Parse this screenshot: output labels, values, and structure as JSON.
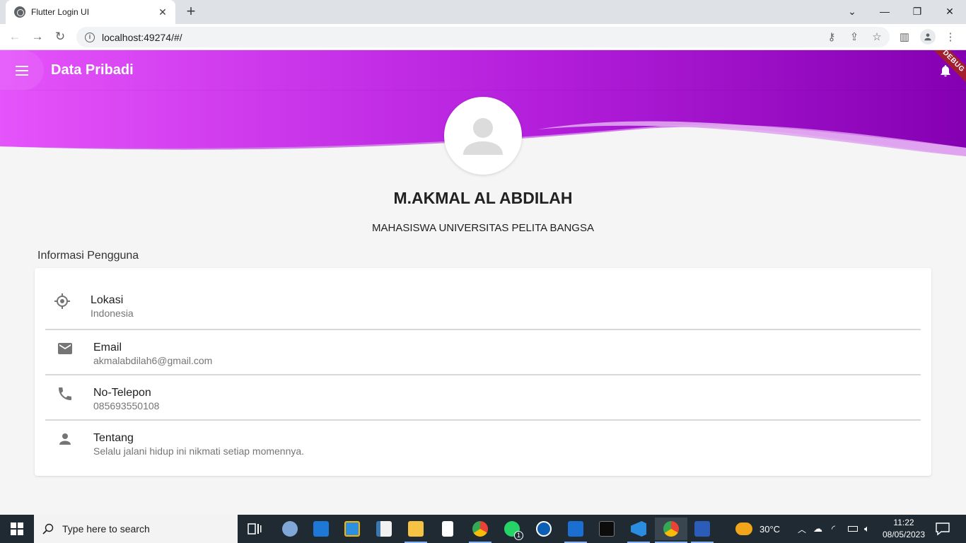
{
  "browser": {
    "tab_title": "Flutter Login UI",
    "tab_close": "✕",
    "new_tab": "+",
    "url": "localhost:49274/#/",
    "window_controls": {
      "chevron": "⌄",
      "minimize": "—",
      "restore": "❐",
      "close": "✕"
    },
    "nav": {
      "back": "←",
      "forward": "→",
      "reload": "↻"
    },
    "toolbar_icons": {
      "key": "⚷",
      "share": "⇪",
      "bookmark": "☆",
      "sidepanel": "▥",
      "menu": "⋮"
    }
  },
  "app": {
    "appbar_title": "Data Pribadi",
    "debug_banner": "DEBUG",
    "gradient": {
      "start": "#e14ef9",
      "mid": "#b21fd9",
      "end": "#8a00b5"
    },
    "profile": {
      "name": "M.AKMAL AL ABDILAH",
      "role": "MAHASISWA UNIVERSITAS PELITA BANGSA"
    },
    "section_title": "Informasi Pengguna",
    "info_items": [
      {
        "icon": "location-icon",
        "label": "Lokasi",
        "value": "Indonesia"
      },
      {
        "icon": "email-icon",
        "label": "Email",
        "value": "akmalabdilah6@gmail.com"
      },
      {
        "icon": "phone-icon",
        "label": "No-Telepon",
        "value": "085693550108"
      },
      {
        "icon": "person-icon",
        "label": "Tentang",
        "value": "Selalu jalani hidup ini nikmati setiap momennya."
      }
    ]
  },
  "taskbar": {
    "search_placeholder": "Type here to search",
    "weather": "30°C",
    "time": "11:22",
    "date": "08/05/2023",
    "whatsapp_badge": "1"
  }
}
